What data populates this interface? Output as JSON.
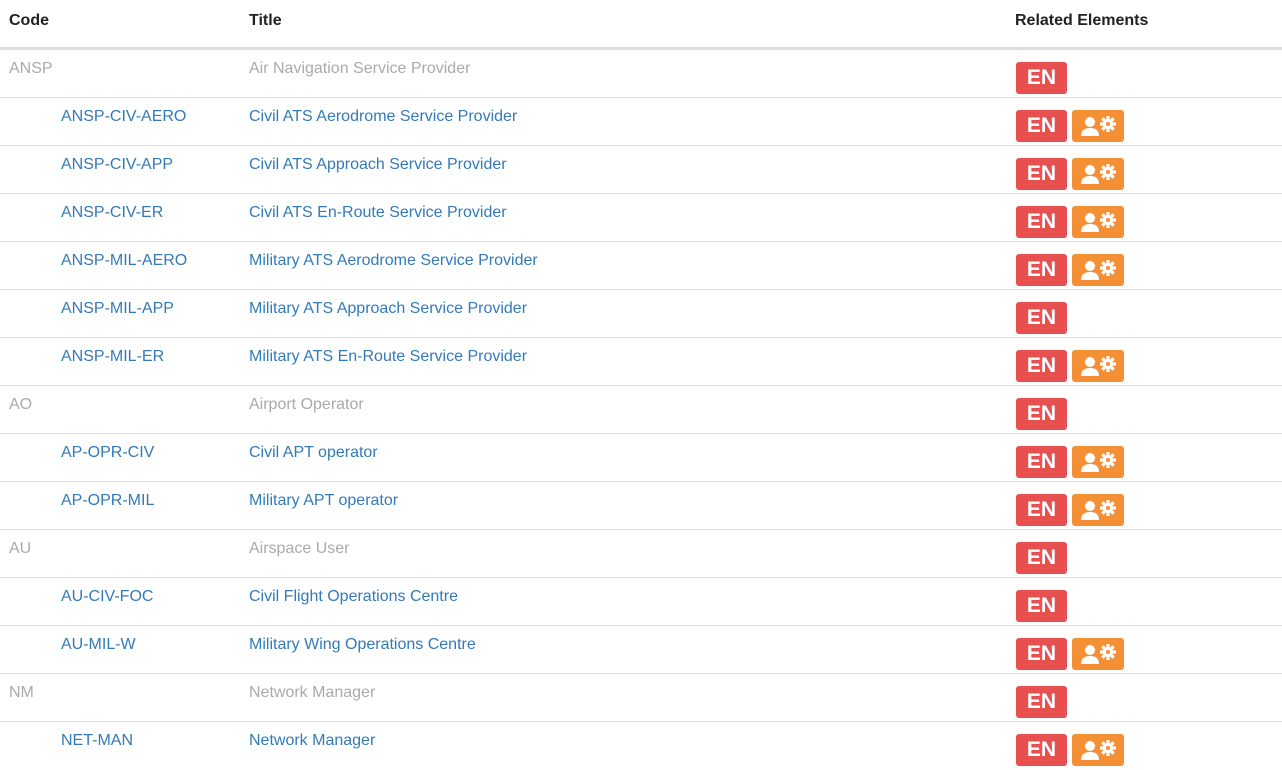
{
  "table": {
    "headers": {
      "code": "Code",
      "title": "Title",
      "related": "Related Elements"
    },
    "badge_en_label": "EN",
    "badge_role_icon": "user-gear-icon",
    "colors": {
      "link": "#337ab7",
      "parent_text": "#aaaaaa",
      "en_badge": "#e8504f",
      "role_badge": "#f58f33"
    },
    "rows": [
      {
        "code": "ANSP",
        "title": "Air Navigation Service Provider",
        "level": "parent",
        "related": [
          "EN"
        ]
      },
      {
        "code": "ANSP-CIV-AERO",
        "title": "Civil ATS Aerodrome Service Provider",
        "level": "child",
        "related": [
          "EN",
          "user-gear-icon"
        ]
      },
      {
        "code": "ANSP-CIV-APP",
        "title": "Civil ATS Approach Service Provider",
        "level": "child",
        "related": [
          "EN",
          "user-gear-icon"
        ]
      },
      {
        "code": "ANSP-CIV-ER",
        "title": "Civil ATS En-Route Service Provider",
        "level": "child",
        "related": [
          "EN",
          "user-gear-icon"
        ]
      },
      {
        "code": "ANSP-MIL-AERO",
        "title": "Military ATS Aerodrome Service Provider",
        "level": "child",
        "related": [
          "EN",
          "user-gear-icon"
        ]
      },
      {
        "code": "ANSP-MIL-APP",
        "title": "Military ATS Approach Service Provider",
        "level": "child",
        "related": [
          "EN"
        ]
      },
      {
        "code": "ANSP-MIL-ER",
        "title": "Military ATS En-Route Service Provider",
        "level": "child",
        "related": [
          "EN",
          "user-gear-icon"
        ]
      },
      {
        "code": "AO",
        "title": "Airport Operator",
        "level": "parent",
        "related": [
          "EN"
        ]
      },
      {
        "code": "AP-OPR-CIV",
        "title": "Civil APT operator",
        "level": "child",
        "related": [
          "EN",
          "user-gear-icon"
        ]
      },
      {
        "code": "AP-OPR-MIL",
        "title": "Military APT operator",
        "level": "child",
        "related": [
          "EN",
          "user-gear-icon"
        ]
      },
      {
        "code": "AU",
        "title": "Airspace User",
        "level": "parent",
        "related": [
          "EN"
        ]
      },
      {
        "code": "AU-CIV-FOC",
        "title": "Civil Flight Operations Centre",
        "level": "child",
        "related": [
          "EN"
        ]
      },
      {
        "code": "AU-MIL-W",
        "title": "Military Wing Operations Centre",
        "level": "child",
        "related": [
          "EN",
          "user-gear-icon"
        ]
      },
      {
        "code": "NM",
        "title": "Network Manager",
        "level": "parent",
        "related": [
          "EN"
        ]
      },
      {
        "code": "NET-MAN",
        "title": "Network Manager",
        "level": "child",
        "related": [
          "EN",
          "user-gear-icon"
        ]
      }
    ]
  }
}
